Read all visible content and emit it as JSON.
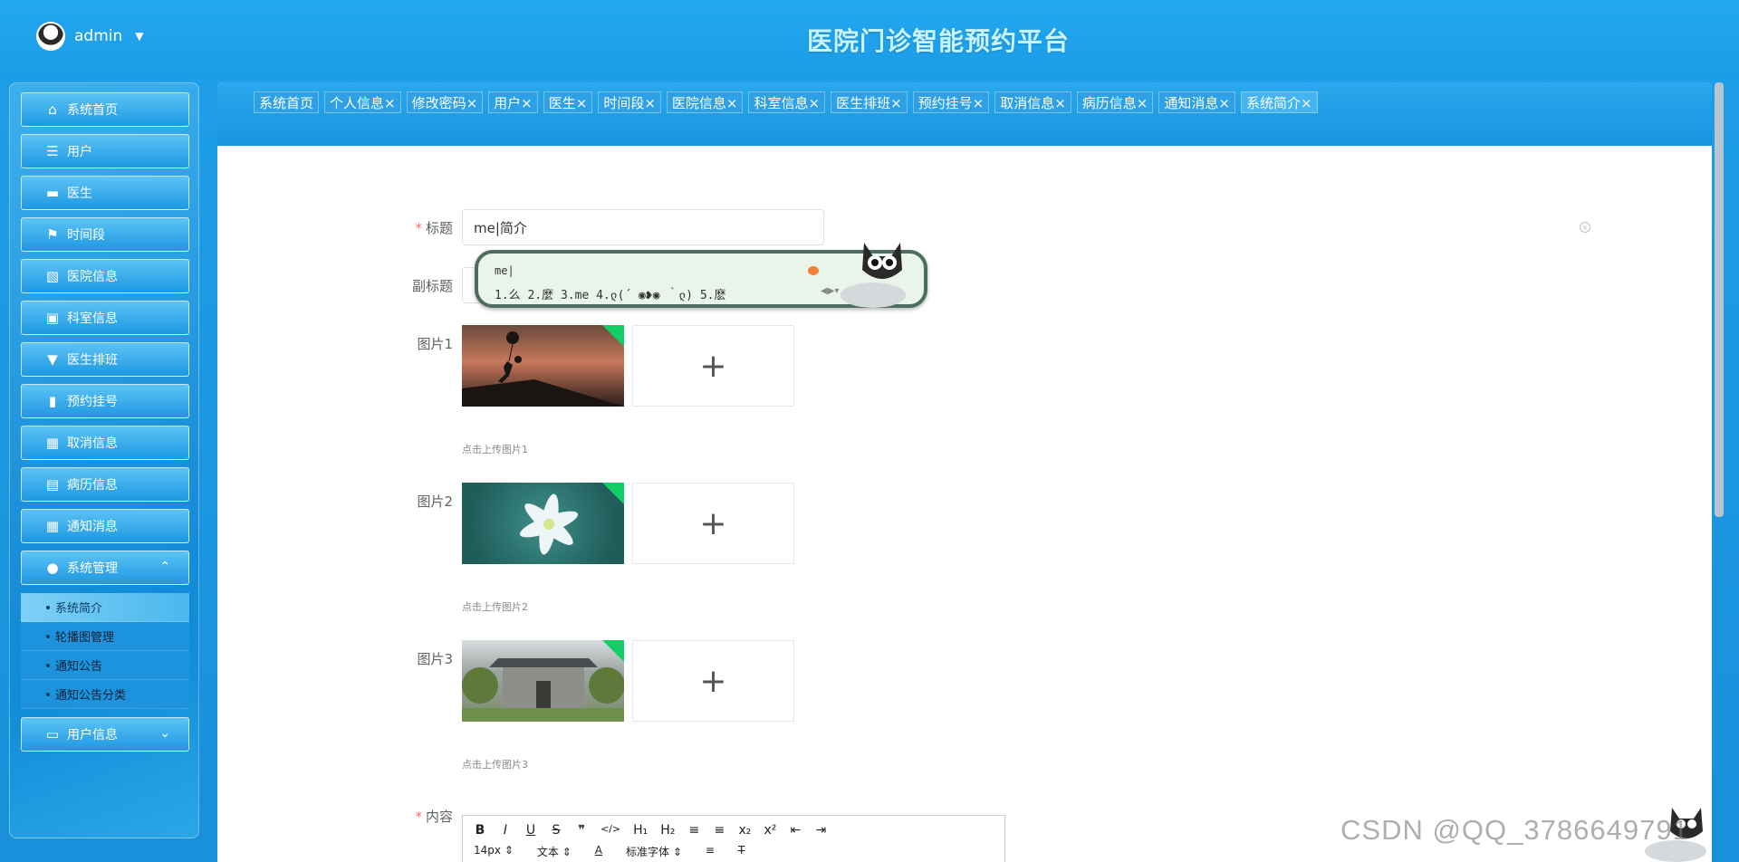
{
  "header": {
    "user": "admin",
    "title": "医院门诊智能预约平台"
  },
  "sidebar": {
    "items": [
      {
        "label": "系统首页",
        "icon": "home-icon"
      },
      {
        "label": "用户",
        "icon": "list-icon"
      },
      {
        "label": "医生",
        "icon": "monitor-icon"
      },
      {
        "label": "时间段",
        "icon": "flag-icon"
      },
      {
        "label": "医院信息",
        "icon": "chart-icon"
      },
      {
        "label": "科室信息",
        "icon": "briefcase-icon"
      },
      {
        "label": "医生排班",
        "icon": "brush-icon"
      },
      {
        "label": "预约挂号",
        "icon": "book-icon"
      },
      {
        "label": "取消信息",
        "icon": "grid-icon"
      },
      {
        "label": "病历信息",
        "icon": "clipboard-icon"
      },
      {
        "label": "通知消息",
        "icon": "grid-icon"
      },
      {
        "label": "系统管理",
        "icon": "bulb-icon"
      },
      {
        "label": "用户信息",
        "icon": "card-icon"
      }
    ],
    "submenu": [
      "系统简介",
      "轮播图管理",
      "通知公告",
      "通知公告分类"
    ]
  },
  "tabs": [
    {
      "label": "系统首页"
    },
    {
      "label": "个人信息×"
    },
    {
      "label": "修改密码×"
    },
    {
      "label": "用户×"
    },
    {
      "label": "医生×"
    },
    {
      "label": "时间段×"
    },
    {
      "label": "医院信息×"
    },
    {
      "label": "科室信息×"
    },
    {
      "label": "医生排班×"
    },
    {
      "label": "预约挂号×"
    },
    {
      "label": "取消信息×"
    },
    {
      "label": "病历信息×"
    },
    {
      "label": "通知消息×"
    },
    {
      "label": "系统简介×"
    }
  ],
  "form": {
    "title_label": "标题",
    "title_value": "me|简介",
    "subtitle_label": "副标题",
    "image1_label": "图片1",
    "image1_hint": "点击上传图片1",
    "image2_label": "图片2",
    "image2_hint": "点击上传图片2",
    "image3_label": "图片3",
    "image3_hint": "点击上传图片3",
    "content_label": "内容",
    "upload_plus": "+"
  },
  "ime": {
    "input": "me|",
    "candidates": "1.么  2.麼  3.me  4.ლ(´ ◉❥◉ ｀ლ)  5.麽"
  },
  "editor": {
    "row1": [
      "B",
      "I",
      "U",
      "S",
      "❞",
      "</>",
      "H₁",
      "H₂",
      "≡",
      "≡",
      "x₂",
      "x²",
      "⇤",
      "⇥"
    ],
    "font_size": "14px",
    "format": "文本",
    "font_family": "标准字体",
    "color_btn": "A"
  },
  "watermark": "CSDN @QQ_3786649791"
}
